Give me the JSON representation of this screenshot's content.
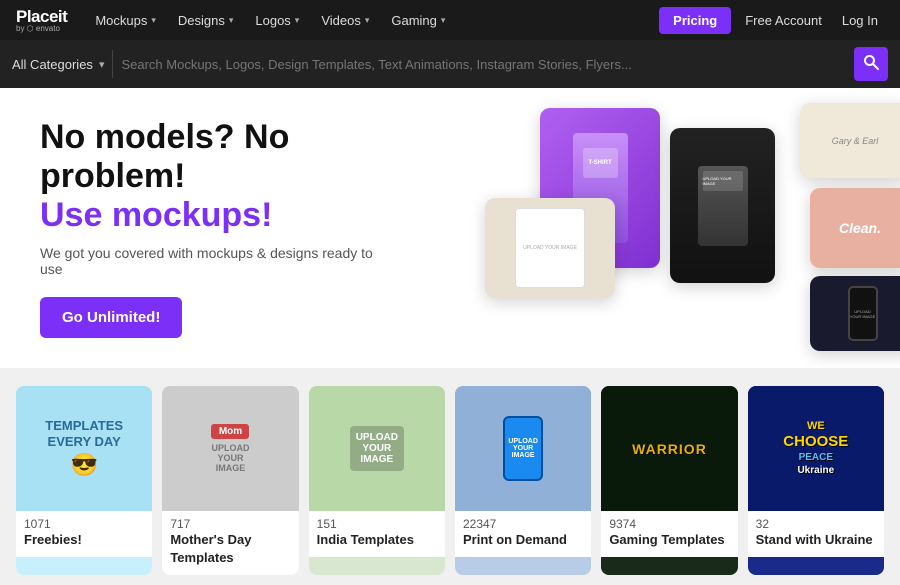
{
  "nav": {
    "logo_main": "Placeit",
    "logo_sub": "by ⬡ envato",
    "menu_items": [
      {
        "label": "Mockups",
        "has_chevron": true
      },
      {
        "label": "Designs",
        "has_chevron": true
      },
      {
        "label": "Logos",
        "has_chevron": true
      },
      {
        "label": "Videos",
        "has_chevron": true
      },
      {
        "label": "Gaming",
        "has_chevron": true
      }
    ],
    "pricing_btn": "Pricing",
    "free_btn": "Free Account",
    "login_btn": "Log In"
  },
  "search": {
    "category_label": "All Categories",
    "placeholder": "Search Mockups, Logos, Design Templates, Text Animations, Instagram Stories, Flyers...",
    "search_icon": "🔍"
  },
  "hero": {
    "title_black": "No models? No problem!",
    "title_purple": "Use mockups!",
    "subtitle": "We got you covered with mockups & designs ready to use",
    "cta_btn": "Go Unlimited!"
  },
  "categories": [
    {
      "count": "1071",
      "label": "Freebies!",
      "bg": "cat-freebies",
      "text_color": "#333",
      "display_text": "TEMPLATES\nEVERY DAY"
    },
    {
      "count": "717",
      "label": "Mother's Day Templates",
      "bg": "cat-mothers",
      "text_color": "#333",
      "display_text": "Mom"
    },
    {
      "count": "151",
      "label": "India Templates",
      "bg": "cat-india",
      "text_color": "#333",
      "display_text": "UPLOAD\nYOUR\nIMAGE"
    },
    {
      "count": "22347",
      "label": "Print on Demand",
      "bg": "cat-print",
      "text_color": "#fff",
      "display_text": "UPLOAD\nYOUR\nIMAGE"
    },
    {
      "count": "9374",
      "label": "Gaming Templates",
      "bg": "cat-gaming",
      "text_color": "#fff",
      "display_text": "WARRIOR"
    },
    {
      "count": "32",
      "label": "Stand with Ukraine",
      "bg": "cat-ukraine",
      "text_color": "#fff",
      "display_text": "WE\nCHOOSE\nPEACE\nUkraine"
    }
  ]
}
